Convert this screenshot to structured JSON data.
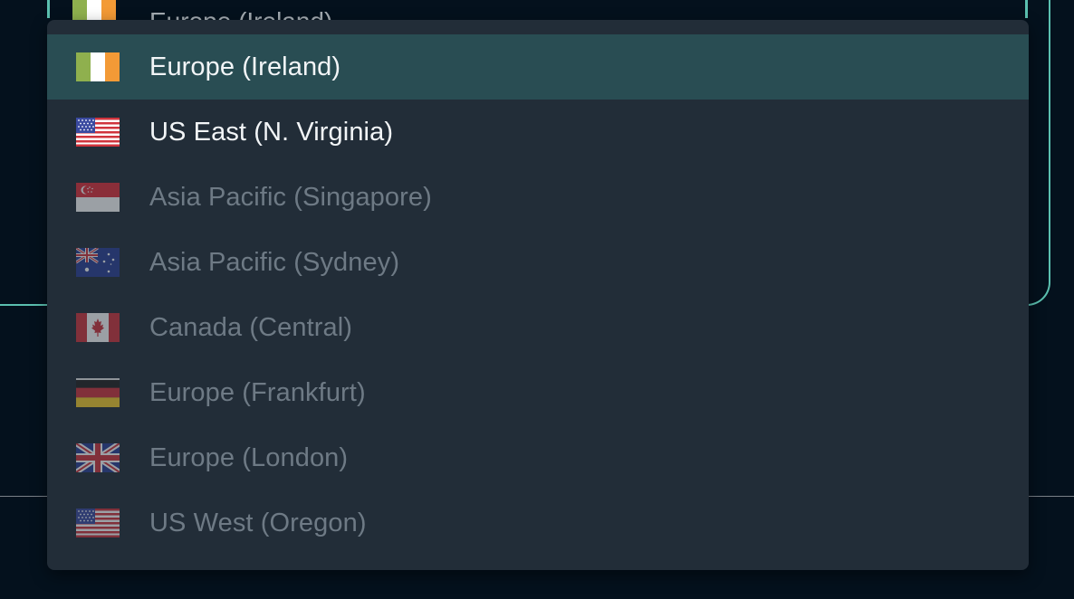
{
  "trigger": {
    "value": "Europe (Ireland)"
  },
  "region_menu": {
    "options": [
      {
        "label": "Europe (Ireland)",
        "flag_icon": "ireland-flag-icon",
        "state": "selected"
      },
      {
        "label": "US East (N. Virginia)",
        "flag_icon": "usa-flag-icon",
        "state": "enabled"
      },
      {
        "label": "Asia Pacific (Singapore)",
        "flag_icon": "singapore-flag-icon",
        "state": "disabled"
      },
      {
        "label": "Asia Pacific (Sydney)",
        "flag_icon": "australia-flag-icon",
        "state": "disabled"
      },
      {
        "label": "Canada (Central)",
        "flag_icon": "canada-flag-icon",
        "state": "disabled"
      },
      {
        "label": "Europe (Frankfurt)",
        "flag_icon": "germany-flag-icon",
        "state": "disabled"
      },
      {
        "label": "Europe (London)",
        "flag_icon": "uk-flag-icon",
        "state": "disabled"
      },
      {
        "label": "US West (Oregon)",
        "flag_icon": "usa-flag-icon",
        "state": "disabled"
      }
    ]
  },
  "colors": {
    "page_background": "#04111d",
    "menu_background": "#222d38",
    "selected_background": "#294d53",
    "accent_border": "#5bc0b0",
    "enabled_text": "#f2f5f7",
    "disabled_text": "#6e7a85"
  }
}
